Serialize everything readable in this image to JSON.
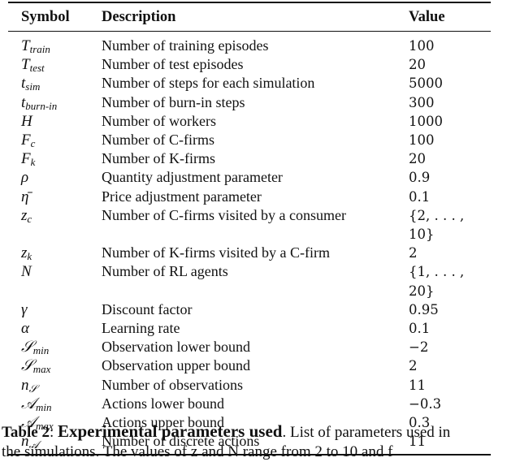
{
  "table": {
    "headers": {
      "symbol": "Symbol",
      "description": "Description",
      "value": "Value"
    },
    "rows": [
      {
        "sym_base": "T",
        "sym_sub": "train",
        "description": "Number of training episodes",
        "value": "100"
      },
      {
        "sym_base": "T",
        "sym_sub": "test",
        "description": "Number of test episodes",
        "value": "20"
      },
      {
        "sym_base": "t",
        "sym_sub": "sim",
        "description": "Number of steps for each simulation",
        "value": "5000"
      },
      {
        "sym_base": "t",
        "sym_sub": "burn-in",
        "description": "Number of burn-in steps",
        "value": "300"
      },
      {
        "sym_base": "H",
        "sym_sub": "",
        "description": "Number of workers",
        "value": "1000"
      },
      {
        "sym_base": "F",
        "sym_sub": "c",
        "description": "Number of C-firms",
        "value": "100"
      },
      {
        "sym_base": "F",
        "sym_sub": "k",
        "description": "Number of K-firms",
        "value": "20"
      },
      {
        "sym_base": "ρ",
        "sym_sub": "",
        "description": "Quantity adjustment parameter",
        "value": "0.9"
      },
      {
        "sym_base": "η̄",
        "sym_sub": "",
        "description": "Price adjustment parameter",
        "value": "0.1"
      },
      {
        "sym_base": "z",
        "sym_sub": "c",
        "description": "Number of C-firms visited by a consumer",
        "value": "{2, . . . , 10}"
      },
      {
        "sym_base": "z",
        "sym_sub": "k",
        "description": "Number of K-firms visited by a C-firm",
        "value": "2"
      },
      {
        "sym_base": "N",
        "sym_sub": "",
        "description": "Number of RL agents",
        "value": "{1, . . . , 20}"
      },
      {
        "sym_base": "γ",
        "sym_sub": "",
        "description": "Discount factor",
        "value": "0.95"
      },
      {
        "sym_base": "α",
        "sym_sub": "",
        "description": "Learning rate",
        "value": "0.1"
      },
      {
        "sym_base": "𝒮",
        "sym_sub": "min",
        "description": "Observation lower bound",
        "value": "−2"
      },
      {
        "sym_base": "𝒮",
        "sym_sub": "max",
        "description": "Observation upper bound",
        "value": "2"
      },
      {
        "sym_base": "n",
        "sym_sub": "𝒮",
        "description": "Number of observations",
        "value": "11"
      },
      {
        "sym_base": "𝒜",
        "sym_sub": "min",
        "description": "Actions lower bound",
        "value": "−0.3"
      },
      {
        "sym_base": "𝒜",
        "sym_sub": "max",
        "description": "Actions upper bound",
        "value": "0.3"
      },
      {
        "sym_base": "n",
        "sym_sub": "𝒜",
        "description": "Number of discrete actions",
        "value": "11"
      }
    ]
  },
  "caption": {
    "label": "Table 2",
    "separator": ": ",
    "title": "Experimental parameters used",
    "text": ". List of parameters used in",
    "next_line": "the simulations. The values of z and N range from 2 to 10 and f"
  }
}
